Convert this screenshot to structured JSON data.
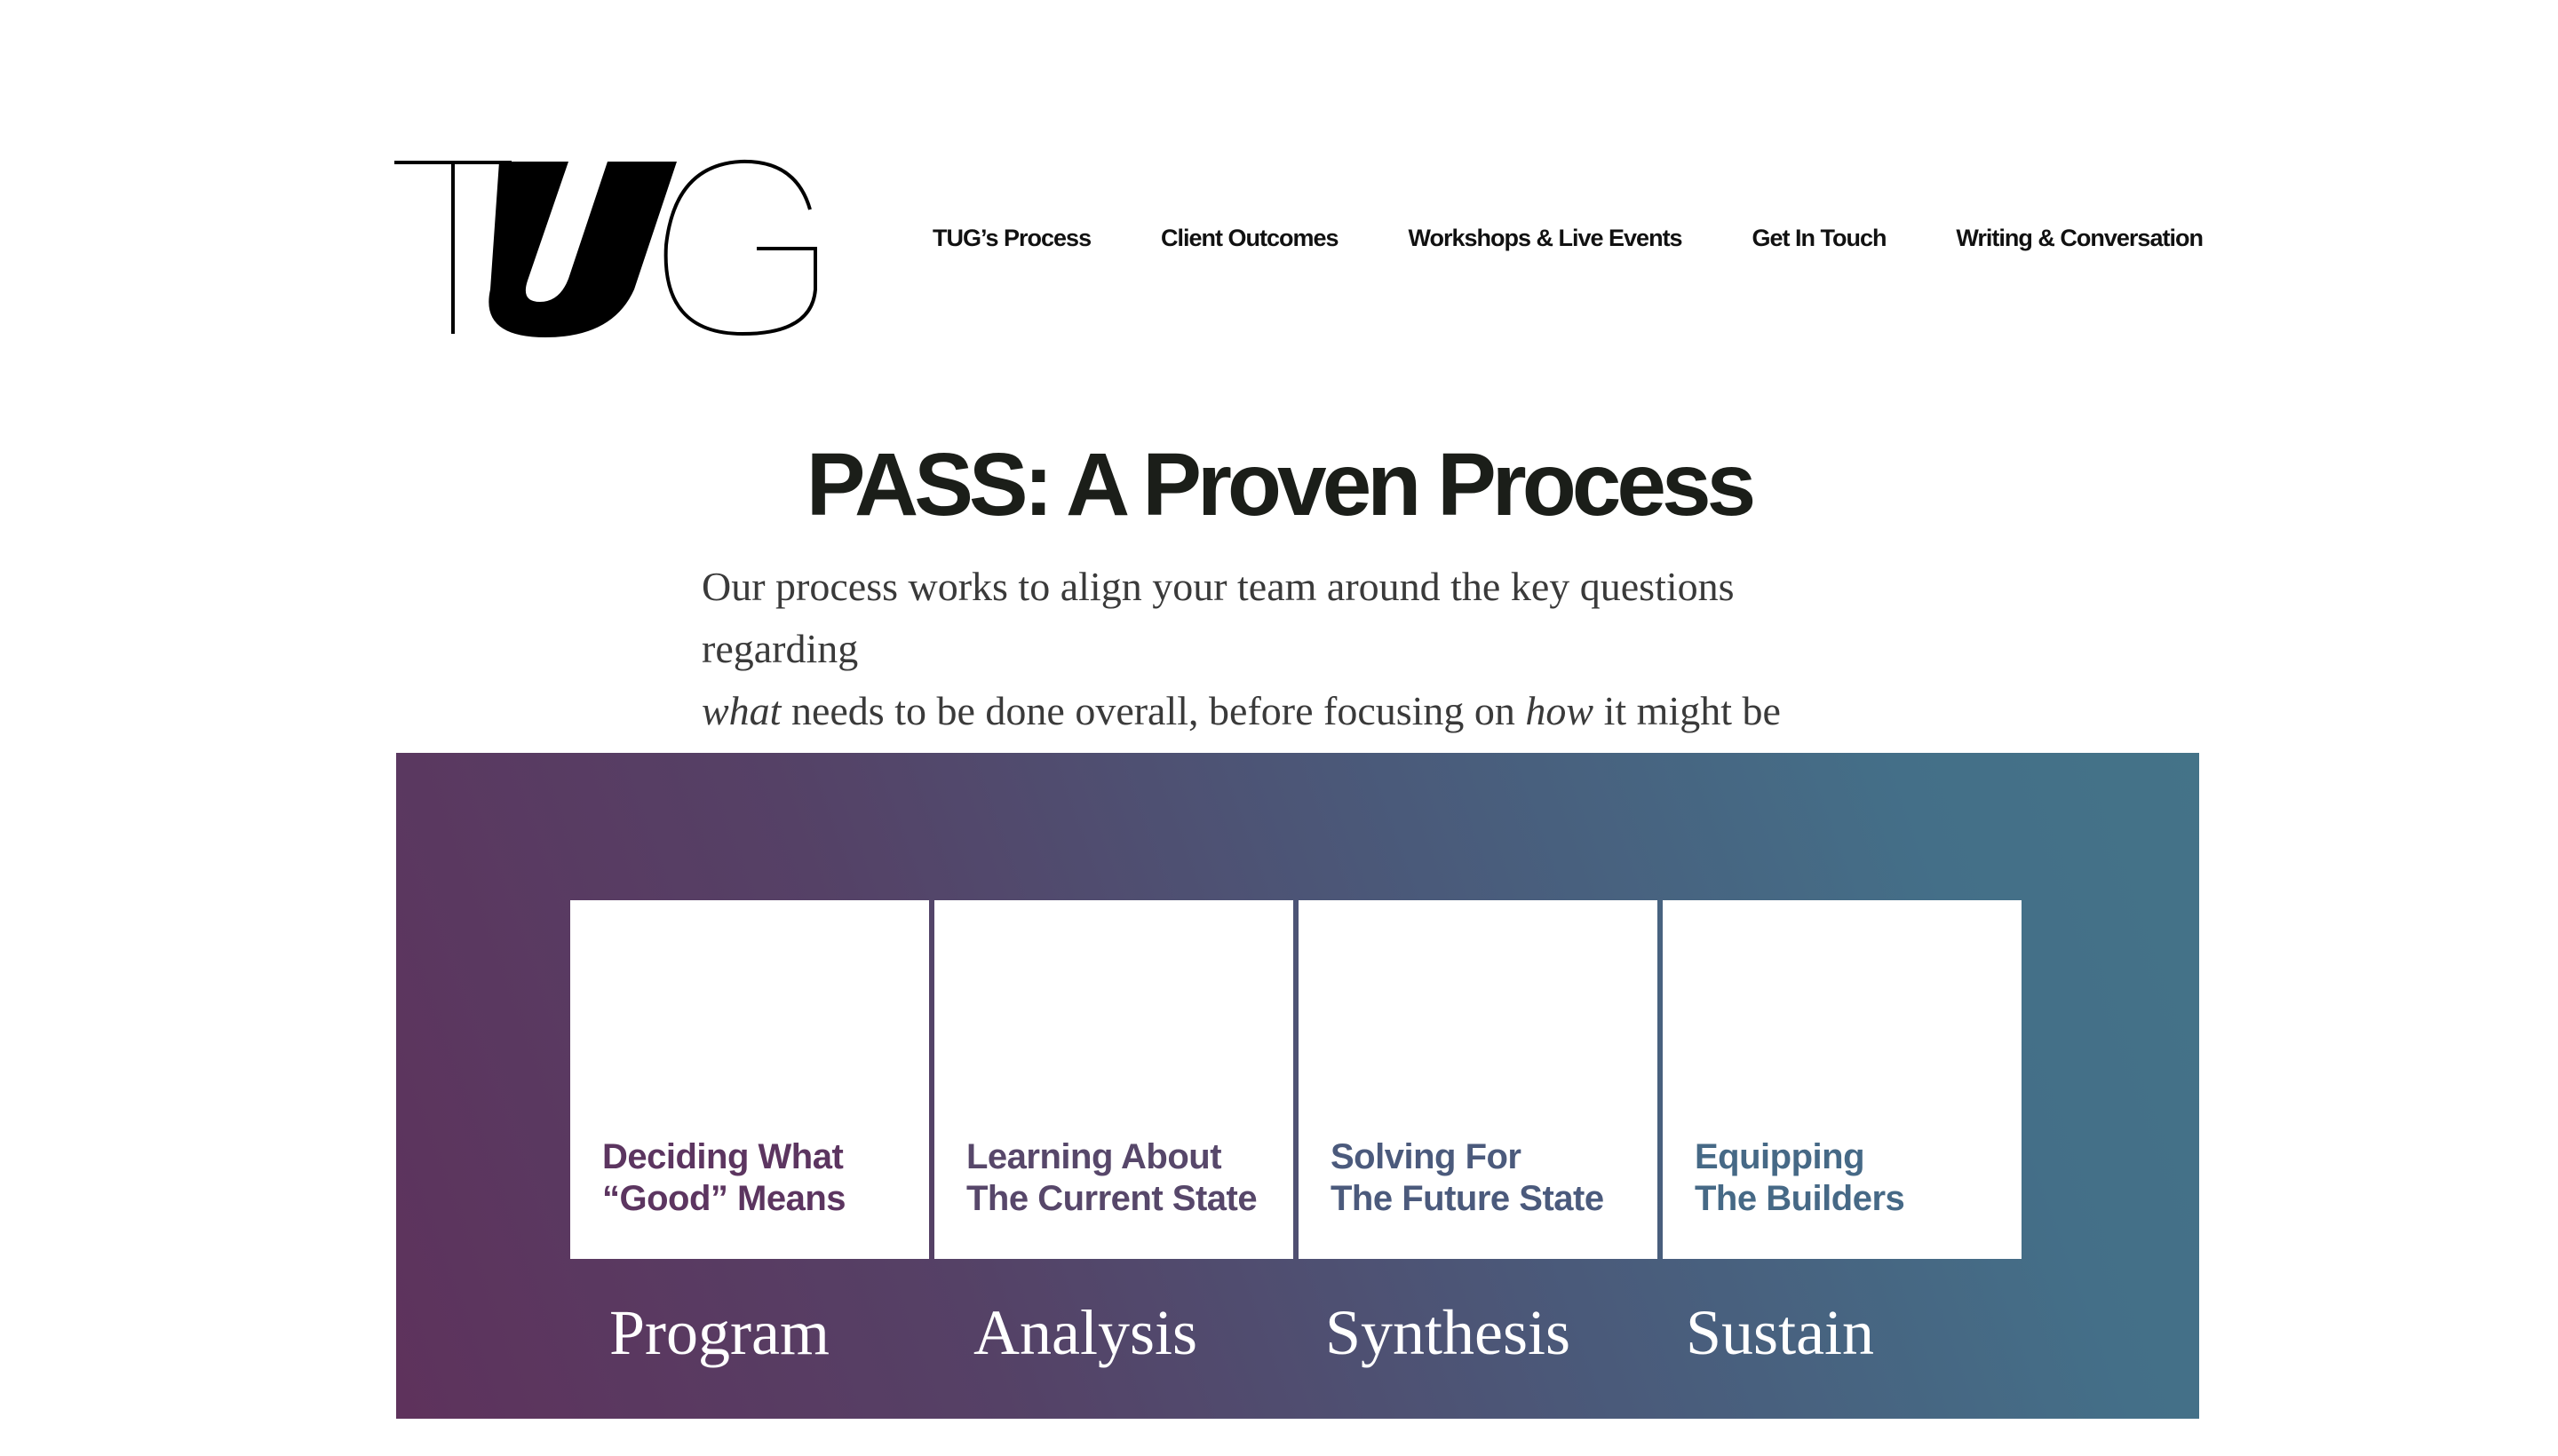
{
  "header": {
    "logo_text": "TUG",
    "nav": [
      {
        "label": "TUG’s Process"
      },
      {
        "label": "Client Outcomes"
      },
      {
        "label": "Workshops & Live Events"
      },
      {
        "label": "Get In Touch"
      },
      {
        "label": "Writing & Conversation"
      }
    ]
  },
  "hero": {
    "title": "PASS: A Proven Process",
    "desc_line1": "Our process works to align your team around the key questions regarding",
    "desc_em1": "what",
    "desc_mid": " needs to be done overall, before focusing on ",
    "desc_em2": "how",
    "desc_end": " it might be done."
  },
  "pass": {
    "phases": [
      {
        "line1": "Deciding What",
        "line2": "“Good” Means",
        "label": "Program",
        "color": "#5c3560"
      },
      {
        "line1": "Learning About",
        "line2": "The Current State",
        "label": "Analysis",
        "color": "#57476a"
      },
      {
        "line1": "Solving For",
        "line2": "The Future State",
        "label": "Synthesis",
        "color": "#4b5a7c"
      },
      {
        "line1": "Equipping",
        "line2": "The Builders",
        "label": "Sustain",
        "color": "#466986"
      }
    ]
  },
  "colors": {
    "text_dark": "#1b1e19",
    "panel_gradient_start": "#5e325c",
    "panel_gradient_end": "#447388"
  }
}
